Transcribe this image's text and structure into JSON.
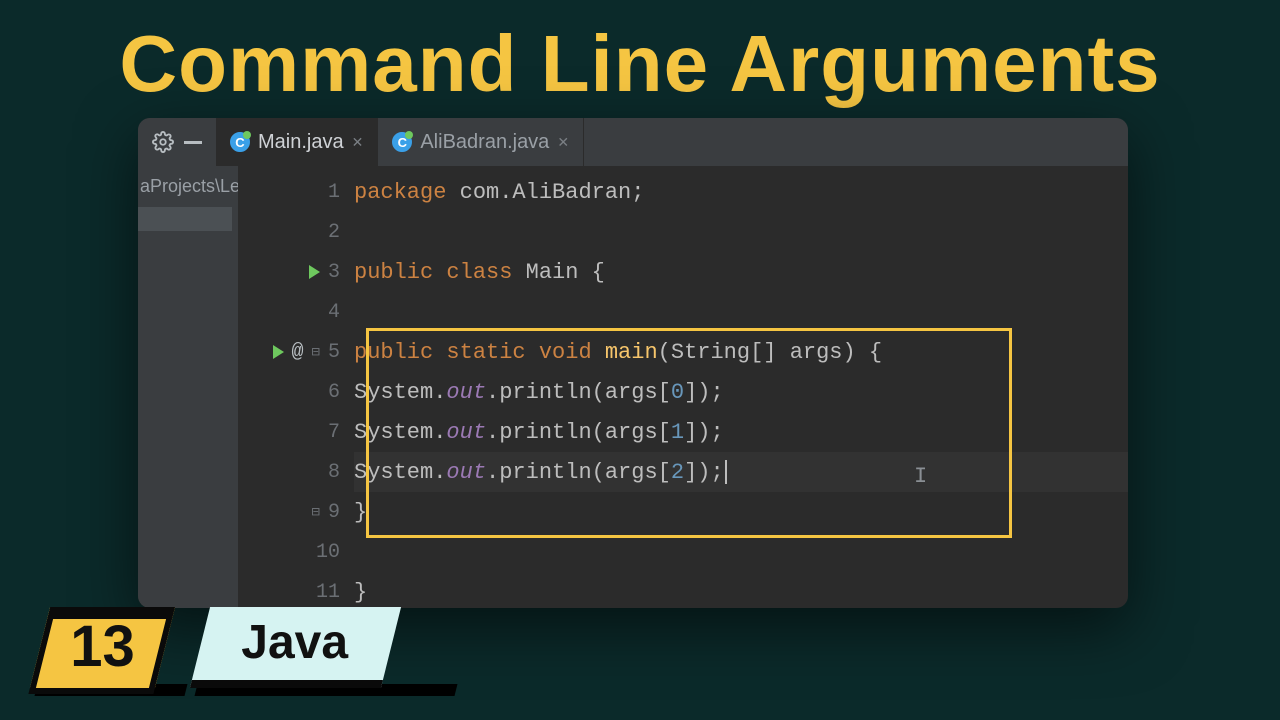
{
  "title": "Command Line Arguments",
  "ide": {
    "tabs": [
      {
        "label": "Main.java",
        "icon_letter": "C",
        "active": true
      },
      {
        "label": "AliBadran.java",
        "icon_letter": "C",
        "active": false
      }
    ],
    "sidebar_peek": "aProjects\\Le",
    "line_numbers": [
      "1",
      "2",
      "3",
      "4",
      "5",
      "6",
      "7",
      "8",
      "9",
      "10",
      "11"
    ],
    "code": {
      "l1": {
        "kw": "package ",
        "rest": "com.AliBadran;"
      },
      "l3": {
        "kw1": "public ",
        "kw2": "class ",
        "name": "Main {"
      },
      "l5": {
        "kw1": "public ",
        "kw2": "static ",
        "kw3": "void ",
        "mname": "main",
        "sig_open": "(String[] args) {"
      },
      "println_prefix": "System.",
      "println_out": "out",
      "println_mid": ".println(args[",
      "println_end": "]);",
      "idx0": "0",
      "idx1": "1",
      "idx2": "2",
      "l9": "}",
      "l11": "}"
    }
  },
  "badges": {
    "number": "13",
    "language": "Java"
  }
}
